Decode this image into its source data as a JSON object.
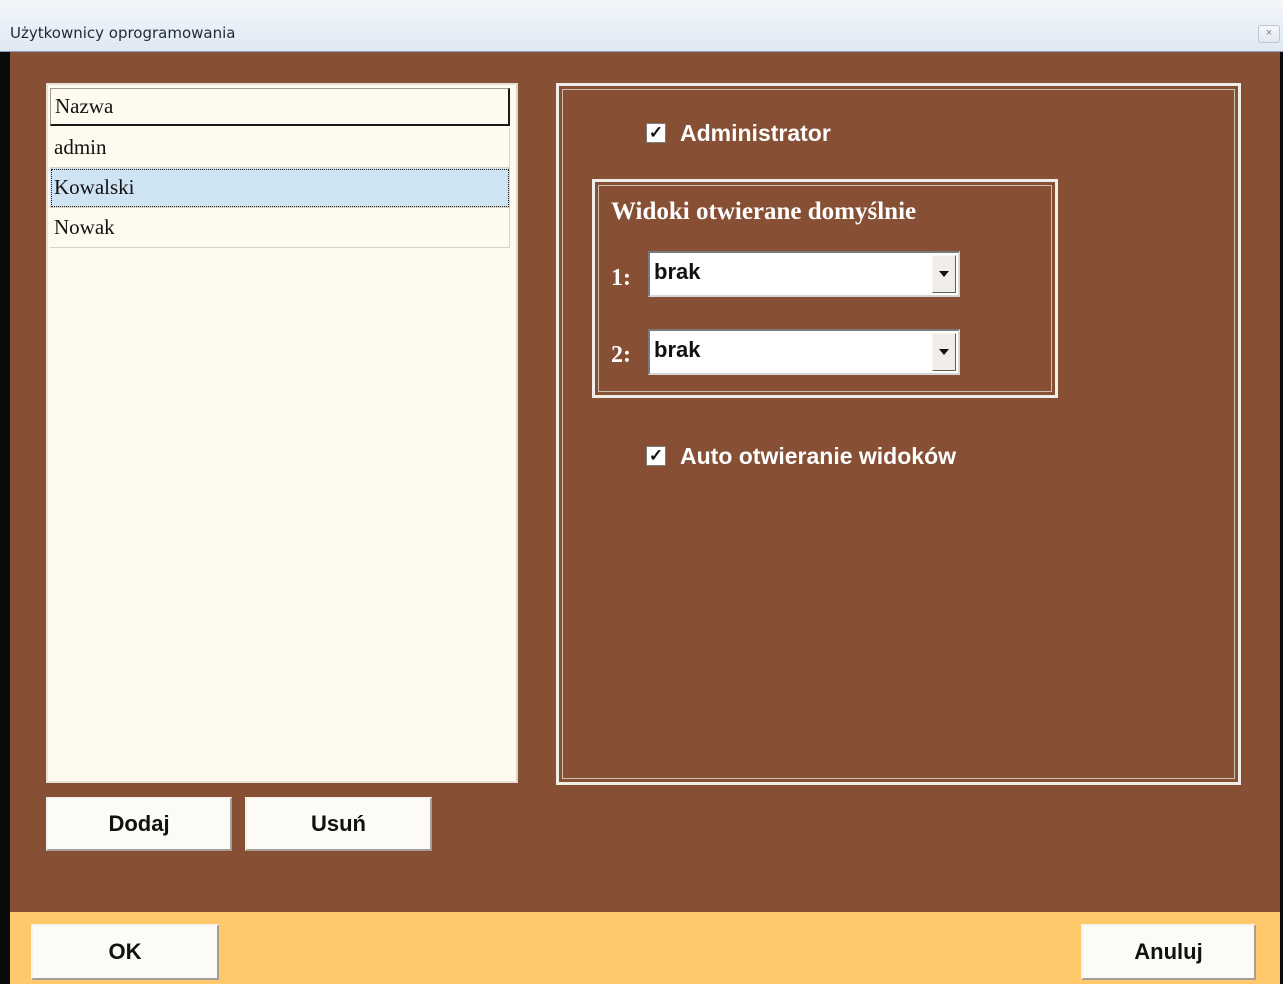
{
  "window": {
    "title": "Użytkownicy oprogramowania",
    "close_glyph": "×"
  },
  "users": {
    "header": "Nazwa",
    "items": [
      "admin",
      "Kowalski",
      "Nowak"
    ],
    "selected": "Kowalski"
  },
  "list_actions": {
    "add_label": "Dodaj",
    "remove_label": "Usuń"
  },
  "settings": {
    "administrator_label": "Administrator",
    "administrator_checked": true,
    "default_views_title": "Widoki otwierane domyślnie",
    "view_slots": [
      {
        "number": "1:",
        "value": "brak"
      },
      {
        "number": "2:",
        "value": "brak"
      }
    ],
    "auto_open_label": "Auto otwieranie widoków",
    "auto_open_checked": true,
    "check_glyph": "✓"
  },
  "dialog_actions": {
    "ok_label": "OK",
    "cancel_label": "Anuluj"
  },
  "colors": {
    "background": "#874f34",
    "list_background": "#fffaee",
    "selected_row": "#cfe4f2",
    "bottom_bar": "#ffc86a",
    "label_text": "#ffffff"
  }
}
